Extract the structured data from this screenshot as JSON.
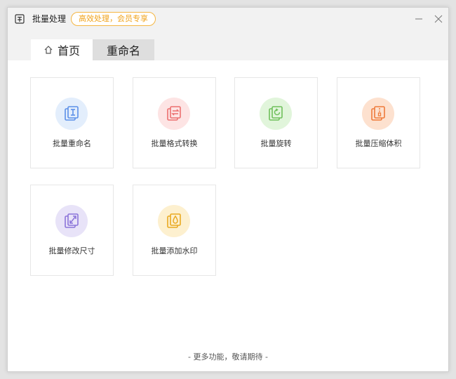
{
  "window": {
    "title": "批量处理",
    "badge": "高效处理，会员专享",
    "minimize_icon": "minimize-icon",
    "close_icon": "close-icon",
    "accent_color": "#f0a21a"
  },
  "tabs": [
    {
      "label": "首页",
      "icon": "home-icon",
      "active": true
    },
    {
      "label": "重命名",
      "active": false
    }
  ],
  "cards": [
    {
      "label": "批量重命名",
      "icon": "rename-icon",
      "circle_color": "#e3eefc",
      "icon_color": "#5b8fe8"
    },
    {
      "label": "批量格式转换",
      "icon": "convert-format-icon",
      "circle_color": "#fde4e4",
      "icon_color": "#ec6f6f"
    },
    {
      "label": "批量旋转",
      "icon": "rotate-icon",
      "circle_color": "#e1f5db",
      "icon_color": "#6fc05b"
    },
    {
      "label": "批量压缩体积",
      "icon": "compress-icon",
      "circle_color": "#fde1cf",
      "icon_color": "#ee7a3a"
    },
    {
      "label": "批量修改尺寸",
      "icon": "resize-icon",
      "circle_color": "#e8e3f8",
      "icon_color": "#8b74d9"
    },
    {
      "label": "批量添加水印",
      "icon": "watermark-icon",
      "circle_color": "#fdf0cf",
      "icon_color": "#e9a920"
    }
  ],
  "footer": "- 更多功能，敬请期待 -"
}
